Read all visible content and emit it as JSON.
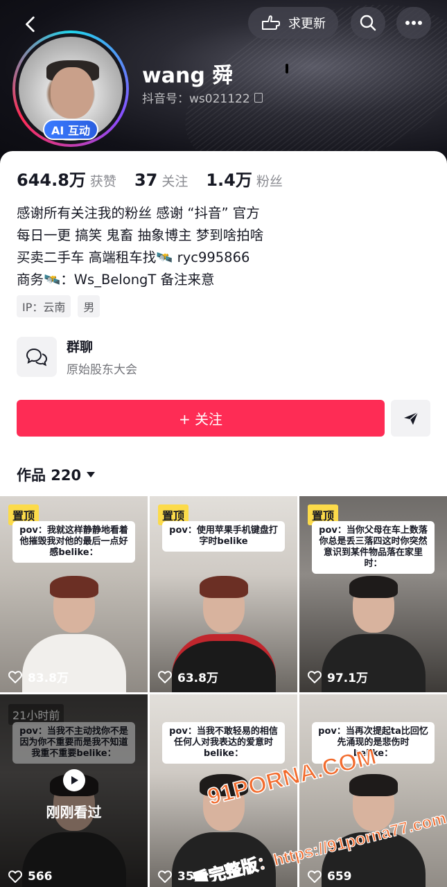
{
  "header": {
    "update_label": "求更新",
    "name": "wang 舜",
    "douyin_id": "抖音号：ws021122",
    "ai_badge": "AI 互动"
  },
  "stats": [
    {
      "num": "644.8万",
      "label": "获赞"
    },
    {
      "num": "37",
      "label": "关注"
    },
    {
      "num": "1.4万",
      "label": "粉丝"
    }
  ],
  "bio": {
    "line1": "感谢所有关注我的粉丝 感谢 “抖音” 官方",
    "line2": "每日一更 搞笑 鬼畜 抽象博主 梦到啥拍啥",
    "line3": "买卖二手车 高端租车找🛰️ ryc995866",
    "line4": "商务🛰️：Ws_BelongT 备注来意"
  },
  "tags": [
    "IP：云南",
    "男"
  ],
  "group": {
    "title": "群聊",
    "subtitle": "原始股东大会"
  },
  "follow_label": "+ 关注",
  "works": {
    "label": "作品 220"
  },
  "videos": [
    {
      "pin": "置顶",
      "caption": "pov：我就这样静静地看着他摧毁我对他的最后一点好感belike：",
      "likes": "83.8万",
      "bg": "bg0",
      "hair": "red",
      "body": "white"
    },
    {
      "pin": "置顶",
      "caption": "pov：使用苹果手机键盘打字时belike",
      "likes": "63.8万",
      "bg": "bg1",
      "hair": "red",
      "body": "red"
    },
    {
      "pin": "置顶",
      "caption": "pov：当你父母在车上数落你总是丢三落四这时你突然意识到某件物品落在家里时：",
      "likes": "97.1万",
      "bg": "bg2",
      "hair": "dark",
      "body": "black"
    },
    {
      "time": "21小时前",
      "caption": "pov：当我不主动找你不是因为你不重要而是我不知道我重不重要belike：",
      "likes": "566",
      "watched": "刚刚看过",
      "bg": "bg3",
      "hair": "dark",
      "body": "black"
    },
    {
      "caption": "pov：当我不敢轻易的相信任何人对我表达的爱意时belike：",
      "likes": "352",
      "bg": "bg1",
      "hair": "dark",
      "body": "black"
    },
    {
      "caption": "pov：当再次提起ta比回忆先涌现的是悲伤时belike：",
      "likes": "659",
      "bg": "bg0",
      "hair": "dark",
      "body": "black"
    }
  ],
  "watermark": {
    "line1": "91PORNA.COM",
    "line2": "看完整版：https://91porna77.com"
  },
  "colors": {
    "accent": "#fe2c55",
    "pin": "#fcdb4a",
    "badge": "#3a7bff"
  }
}
